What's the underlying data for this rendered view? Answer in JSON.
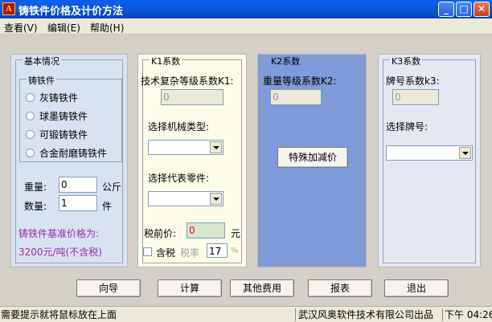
{
  "window": {
    "title": "铸铁件价格及计价方法",
    "icon_glyph": "A",
    "minimize": "_",
    "maximize": "□",
    "close": "✕"
  },
  "menu": [
    {
      "label": "查看(V)"
    },
    {
      "label": "编辑(E)"
    },
    {
      "label": "帮助(H)"
    }
  ],
  "basic": {
    "legend": "基本情况",
    "group_legend": "铸铁件",
    "radios": [
      "灰铸铁件",
      "球墨铸铁件",
      "可锻铸铁件",
      "合金耐磨铸铁件"
    ],
    "weight_label": "重量:",
    "weight_value": "0",
    "weight_unit": "公斤",
    "qty_label": "数量:",
    "qty_value": "1",
    "qty_unit": "件",
    "base_price_label": "铸铁件基准价格为:",
    "base_price_value": "3200元/吨(不含税)"
  },
  "k1": {
    "legend": "K1系数",
    "coef_label": "技术复杂等级系数K1:",
    "coef_value": "0",
    "machine_label": "选择机械类型:",
    "part_label": "选择代表零件:",
    "pretax_label": "税前价:",
    "pretax_value": "0",
    "pretax_unit": "元",
    "tax_label": "含税",
    "rate_label": "税率",
    "rate_value": "17",
    "rate_unit": "%"
  },
  "k2": {
    "legend": "K2系数",
    "coef_label": "重量等级系数K2:",
    "coef_value": "0",
    "special_button": "特殊加减价"
  },
  "k3": {
    "legend": "K3系数",
    "coef_label": "牌号系数k3:",
    "coef_value": "0",
    "grade_label": "选择牌号:"
  },
  "buttons": {
    "guide": "向导",
    "calc": "计算",
    "other": "其他费用",
    "report": "报表",
    "exit": "退出"
  },
  "status": {
    "hint": "需要提示就将鼠标放在上面",
    "company": "武汉风奥软件技术有限公司出品",
    "time": "下午 04:26"
  }
}
